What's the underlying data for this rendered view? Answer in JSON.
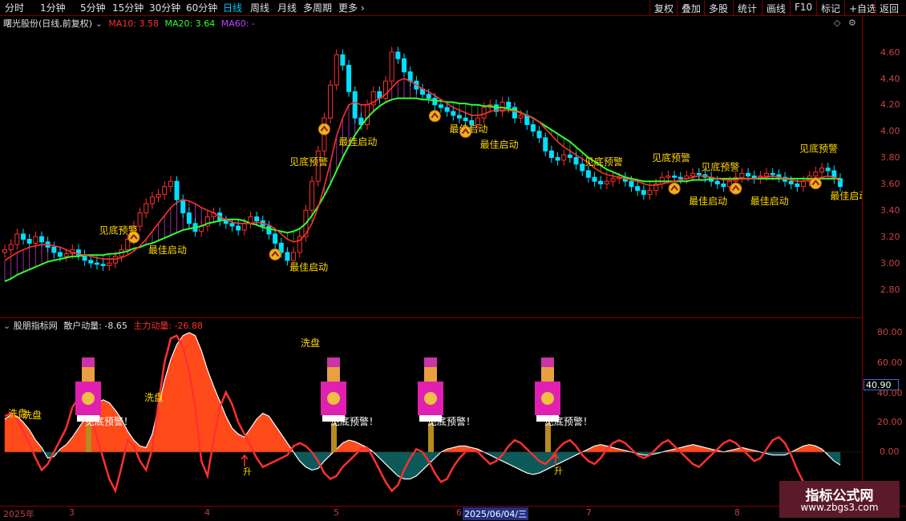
{
  "toolbar": {
    "periods": [
      "分时",
      "1分钟",
      "5分钟",
      "15分钟",
      "30分钟",
      "60分钟",
      "日线",
      "周线",
      "月线",
      "多周期",
      "更多"
    ],
    "active_period": "日线",
    "buttons": [
      "复权",
      "叠加",
      "多股",
      "统计",
      "画线",
      "F10",
      "标记",
      "+自选",
      "返回"
    ]
  },
  "main_panel": {
    "title": "曙光股份(日线,前复权)",
    "ma10_label": "MA10: 3.58",
    "ma20_label": "MA20: 3.64",
    "ma60_label": "MA60: -",
    "colors": {
      "ma10": "#ff3030",
      "ma20": "#30ff30",
      "ma60": "#c040ff",
      "up": "#ff3030",
      "down": "#00e0ff"
    }
  },
  "sub_panel": {
    "title": "股朋指标网",
    "retail_label": "散户动量: -8.65",
    "main_force_label": "主力动量: -26.88",
    "colors": {
      "retail": "#ffffff",
      "main_force": "#ff3030",
      "fill_pos": "#ff4a1a",
      "fill_neg": "#0c5a5a"
    }
  },
  "annotations": {
    "bottom_signal": "最佳启动",
    "top_signal": "见底预警",
    "wash": "洗盘",
    "wash_alt": "洗盘",
    "sub_signal": "见底预警！",
    "rise": "升"
  },
  "dates": {
    "labels": [
      "2025年",
      "3",
      "4",
      "5",
      "6",
      "7",
      "8"
    ],
    "selected": "2025/06/04/三"
  },
  "watermark": {
    "line1": "指标公式网",
    "line2": "www.zbgs3.com"
  },
  "chart_data": [
    {
      "type": "candlestick",
      "title": "曙光股份(日线,前复权)",
      "y_ticks": [
        4.6,
        4.4,
        4.2,
        4.0,
        3.8,
        3.6,
        3.4,
        3.2,
        3.0,
        2.8
      ],
      "ylim": [
        2.72,
        4.8
      ],
      "x_months": [
        "2025年",
        "3",
        "4",
        "5",
        "6",
        "7",
        "8"
      ],
      "close": [
        3.1,
        3.14,
        3.22,
        3.18,
        3.15,
        3.2,
        3.16,
        3.12,
        3.08,
        3.05,
        3.07,
        3.1,
        3.06,
        3.02,
        3.0,
        2.99,
        2.98,
        3.0,
        3.05,
        3.1,
        3.18,
        3.28,
        3.38,
        3.45,
        3.5,
        3.52,
        3.58,
        3.62,
        3.48,
        3.38,
        3.3,
        3.24,
        3.28,
        3.35,
        3.38,
        3.32,
        3.3,
        3.28,
        3.25,
        3.3,
        3.35,
        3.32,
        3.28,
        3.22,
        3.15,
        3.08,
        3.02,
        3.08,
        3.2,
        3.4,
        3.62,
        3.85,
        4.1,
        4.35,
        4.58,
        4.5,
        4.3,
        4.1,
        4.05,
        4.2,
        4.3,
        4.25,
        4.38,
        4.6,
        4.55,
        4.45,
        4.38,
        4.32,
        4.28,
        4.25,
        4.2,
        4.18,
        4.15,
        4.12,
        4.1,
        4.08,
        4.05,
        4.1,
        4.18,
        4.2,
        4.15,
        4.22,
        4.18,
        4.1,
        4.12,
        4.05,
        4.0,
        3.95,
        3.85,
        3.8,
        3.78,
        3.82,
        3.8,
        3.75,
        3.7,
        3.65,
        3.62,
        3.6,
        3.62,
        3.64,
        3.65,
        3.62,
        3.58,
        3.55,
        3.52,
        3.55,
        3.6,
        3.65,
        3.66,
        3.65,
        3.64,
        3.66,
        3.68,
        3.67,
        3.65,
        3.62,
        3.6,
        3.58,
        3.62,
        3.65,
        3.68,
        3.66,
        3.64,
        3.66,
        3.68,
        3.67,
        3.65,
        3.62,
        3.6,
        3.58,
        3.62,
        3.66,
        3.69,
        3.72,
        3.7,
        3.64,
        3.58
      ],
      "ma10": [
        3.02,
        3.05,
        3.08,
        3.1,
        3.12,
        3.13,
        3.14,
        3.14,
        3.13,
        3.12,
        3.1,
        3.08,
        3.07,
        3.06,
        3.05,
        3.04,
        3.03,
        3.03,
        3.03,
        3.04,
        3.06,
        3.09,
        3.13,
        3.18,
        3.24,
        3.3,
        3.36,
        3.42,
        3.46,
        3.48,
        3.47,
        3.45,
        3.42,
        3.4,
        3.38,
        3.35,
        3.33,
        3.31,
        3.3,
        3.3,
        3.3,
        3.31,
        3.3,
        3.29,
        3.26,
        3.22,
        3.18,
        3.16,
        3.17,
        3.22,
        3.3,
        3.42,
        3.58,
        3.76,
        3.96,
        4.1,
        4.2,
        4.22,
        4.2,
        4.2,
        4.22,
        4.25,
        4.28,
        4.33,
        4.38,
        4.4,
        4.38,
        4.35,
        4.32,
        4.3,
        4.27,
        4.24,
        4.21,
        4.18,
        4.16,
        4.14,
        4.12,
        4.12,
        4.13,
        4.15,
        4.16,
        4.16,
        4.16,
        4.15,
        4.14,
        4.12,
        4.1,
        4.07,
        4.02,
        3.97,
        3.92,
        3.88,
        3.85,
        3.82,
        3.79,
        3.76,
        3.72,
        3.69,
        3.67,
        3.66,
        3.65,
        3.64,
        3.63,
        3.62,
        3.6,
        3.59,
        3.59,
        3.6,
        3.61,
        3.62,
        3.63,
        3.64,
        3.65,
        3.66,
        3.66,
        3.65,
        3.64,
        3.63,
        3.63,
        3.63,
        3.64,
        3.64,
        3.64,
        3.65,
        3.65,
        3.66,
        3.65,
        3.64,
        3.63,
        3.62,
        3.62,
        3.63,
        3.64,
        3.65,
        3.66,
        3.65,
        3.62
      ],
      "ma20": [
        2.86,
        2.88,
        2.91,
        2.93,
        2.95,
        2.97,
        2.99,
        3.01,
        3.02,
        3.03,
        3.04,
        3.05,
        3.05,
        3.06,
        3.06,
        3.06,
        3.06,
        3.07,
        3.07,
        3.08,
        3.09,
        3.11,
        3.12,
        3.14,
        3.15,
        3.17,
        3.19,
        3.21,
        3.23,
        3.25,
        3.26,
        3.27,
        3.28,
        3.3,
        3.31,
        3.32,
        3.33,
        3.33,
        3.33,
        3.32,
        3.3,
        3.29,
        3.27,
        3.26,
        3.25,
        3.24,
        3.23,
        3.24,
        3.26,
        3.3,
        3.36,
        3.43,
        3.51,
        3.6,
        3.7,
        3.8,
        3.89,
        3.97,
        4.04,
        4.1,
        4.15,
        4.19,
        4.22,
        4.24,
        4.25,
        4.25,
        4.25,
        4.25,
        4.24,
        4.24,
        4.23,
        4.23,
        4.22,
        4.22,
        4.21,
        4.21,
        4.2,
        4.2,
        4.19,
        4.19,
        4.18,
        4.18,
        4.17,
        4.16,
        4.14,
        4.12,
        4.1,
        4.07,
        4.04,
        4.01,
        3.98,
        3.95,
        3.92,
        3.88,
        3.84,
        3.8,
        3.77,
        3.74,
        3.71,
        3.69,
        3.67,
        3.65,
        3.64,
        3.63,
        3.62,
        3.62,
        3.62,
        3.62,
        3.62,
        3.62,
        3.62,
        3.62,
        3.63,
        3.63,
        3.63,
        3.64,
        3.64,
        3.64,
        3.64,
        3.64,
        3.64,
        3.64,
        3.64,
        3.64,
        3.64,
        3.64,
        3.64,
        3.64,
        3.64,
        3.64,
        3.64,
        3.64,
        3.64,
        3.64,
        3.64,
        3.64,
        3.64
      ],
      "bottom_signal_days": [
        21,
        44,
        52,
        70,
        75,
        109,
        119,
        132
      ],
      "top_signal_days": [
        19,
        50,
        98,
        109,
        117,
        133
      ]
    },
    {
      "type": "area",
      "title": "股朋指标网",
      "y_ticks": [
        80.0,
        60.0,
        40.0,
        20.0,
        0.0
      ],
      "ylim": [
        -30,
        88
      ],
      "current_value_box": "40.90",
      "series": [
        {
          "name": "散户动量",
          "values": [
            22,
            25,
            24,
            20,
            15,
            8,
            3,
            -4,
            -3,
            2,
            5,
            10,
            16,
            22,
            27,
            33,
            35,
            33,
            28,
            22,
            14,
            8,
            4,
            3,
            12,
            30,
            48,
            62,
            72,
            78,
            80,
            78,
            68,
            55,
            44,
            34,
            24,
            16,
            12,
            10,
            16,
            22,
            26,
            24,
            18,
            12,
            6,
            0,
            -6,
            -10,
            -12,
            -11,
            -6,
            -2,
            2,
            6,
            8,
            7,
            5,
            3,
            0,
            -4,
            -8,
            -12,
            -16,
            -18,
            -18,
            -16,
            -12,
            -8,
            -4,
            0,
            2,
            3,
            4,
            4,
            3,
            2,
            0,
            -2,
            -4,
            -6,
            -8,
            -10,
            -12,
            -14,
            -15,
            -14,
            -12,
            -10,
            -8,
            -6,
            -4,
            -2,
            0,
            2,
            4,
            5,
            4,
            3,
            2,
            1,
            0,
            -1,
            -2,
            -2,
            -1,
            0,
            1,
            2,
            3,
            4,
            5,
            4,
            3,
            2,
            1,
            0,
            1,
            2,
            3,
            2,
            1,
            0,
            -1,
            -2,
            -2,
            -2,
            0,
            2,
            4,
            5,
            4,
            2,
            -2,
            -6,
            -8.65
          ]
        },
        {
          "name": "主力动量",
          "values": [
            24,
            26,
            22,
            14,
            6,
            -4,
            -12,
            -8,
            0,
            8,
            16,
            30,
            36,
            34,
            24,
            10,
            -4,
            -18,
            -26,
            -10,
            8,
            4,
            -6,
            -12,
            2,
            32,
            60,
            76,
            78,
            70,
            54,
            30,
            -6,
            -16,
            8,
            30,
            40,
            32,
            20,
            12,
            4,
            -4,
            -10,
            -8,
            -6,
            -4,
            -2,
            4,
            6,
            4,
            0,
            -6,
            -14,
            -18,
            -16,
            -10,
            -6,
            -2,
            2,
            3,
            -4,
            -12,
            -20,
            -26,
            -22,
            -12,
            -4,
            2,
            0,
            -6,
            -14,
            -20,
            -18,
            -10,
            -4,
            0,
            2,
            0,
            -4,
            -8,
            -6,
            -2,
            4,
            8,
            6,
            2,
            -2,
            -6,
            -8,
            -4,
            2,
            6,
            8,
            4,
            -2,
            -6,
            -8,
            -4,
            2,
            6,
            8,
            6,
            2,
            -2,
            -4,
            -2,
            2,
            6,
            8,
            4,
            0,
            -4,
            -8,
            -10,
            -6,
            -2,
            2,
            6,
            8,
            6,
            2,
            -2,
            -6,
            -4,
            2,
            8,
            10,
            6,
            -2,
            -12,
            -20,
            -24,
            -26.88
          ]
        }
      ],
      "xlabel": "",
      "ylabel": ""
    }
  ]
}
